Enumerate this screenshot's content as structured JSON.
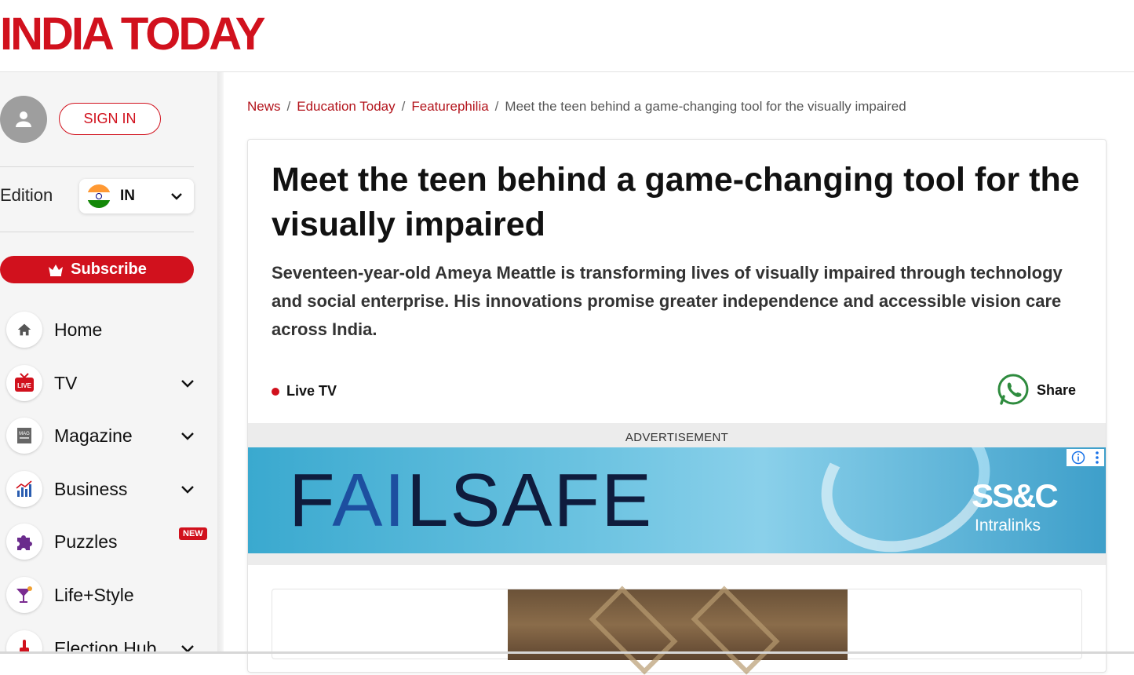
{
  "header": {
    "logo_text": "INDIA TODAY"
  },
  "sidebar": {
    "sign_in": "SIGN IN",
    "edition_label": "Edition",
    "edition_code": "IN",
    "subscribe": "Subscribe",
    "items": [
      {
        "label": "Home",
        "icon": "home-icon",
        "has_chevron": false
      },
      {
        "label": "TV",
        "icon": "live-tv-icon",
        "has_chevron": true
      },
      {
        "label": "Magazine",
        "icon": "magazine-icon",
        "has_chevron": true
      },
      {
        "label": "Business",
        "icon": "business-chart-icon",
        "has_chevron": true
      },
      {
        "label": "Puzzles",
        "icon": "puzzle-icon",
        "badge": "NEW"
      },
      {
        "label": "Life+Style",
        "icon": "cocktail-icon",
        "has_chevron": false
      },
      {
        "label": "Election Hub",
        "icon": "election-icon",
        "has_chevron": true
      }
    ]
  },
  "breadcrumb": {
    "items": [
      "News",
      "Education Today",
      "Featurephilia"
    ],
    "current": "Meet the teen behind a game-changing tool for the visually impaired",
    "separator": "/"
  },
  "article": {
    "title": "Meet the teen behind a game-changing tool for the visually impaired",
    "summary": "Seventeen-year-old Ameya Meattle is transforming lives of visually impaired through technology and social enterprise. His innovations promise greater independence and accessible vision care across India.",
    "live_tv_label": "Live TV",
    "share_label": "Share"
  },
  "advertisement": {
    "label": "ADVERTISEMENT",
    "brand_pre": "F",
    "brand_ai": "AI",
    "brand_post": "LSAFE",
    "sponsor_logo": "SS&C",
    "sponsor_sub": "Intralinks"
  },
  "colors": {
    "brand_red": "#d1111d",
    "breadcrumb_link": "#b3141c"
  }
}
